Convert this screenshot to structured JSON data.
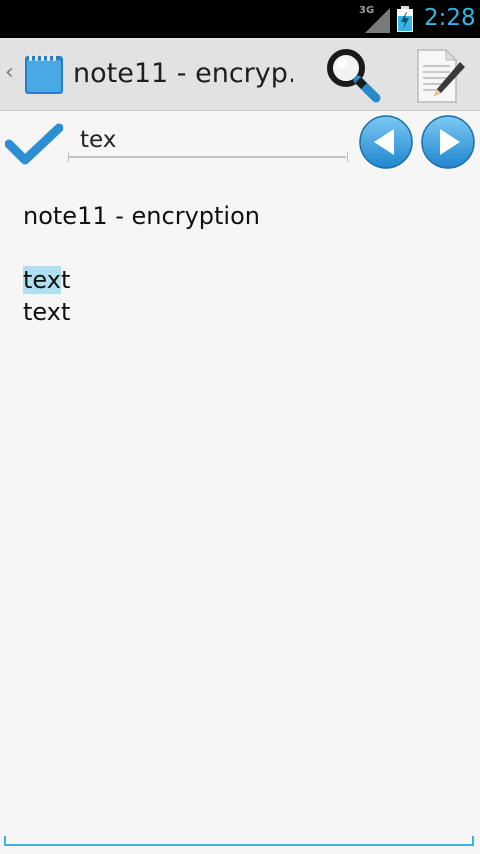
{
  "status_bar": {
    "network": "3G",
    "time": "2:28",
    "icons": [
      "signal-icon",
      "battery-charging-icon"
    ]
  },
  "action_bar": {
    "up_caret": "‹",
    "app_icon": "notepad-icon",
    "title": "note11 - encryp…",
    "actions": [
      "search-icon",
      "edit-icon"
    ]
  },
  "find_bar": {
    "query": "tex",
    "done_icon": "checkmark-icon",
    "prev_icon": "previous-match-icon",
    "next_icon": "next-match-icon"
  },
  "note": {
    "line1": "note11 - encryption",
    "line2": "",
    "line3_match": "tex",
    "line3_rest": "t",
    "line4": "text"
  },
  "colors": {
    "accent": "#33b5e5",
    "highlight": "#aee0f2",
    "action_bar_bg": "#e2e2e2",
    "background": "#f6f6f6"
  }
}
